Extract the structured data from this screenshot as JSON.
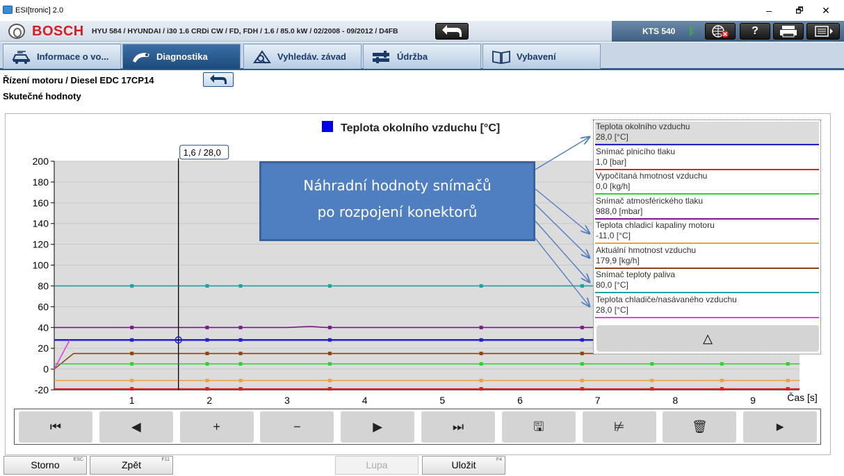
{
  "window": {
    "title": "ESI[tronic] 2.0",
    "controls": [
      "–",
      "🗗",
      "✕"
    ]
  },
  "header": {
    "brand": "BOSCH",
    "vehicle": "HYU 584 / HYUNDAI / i30 1.6 CRDi CW / FD, FDH / 1.6 / 85.0 kW / 02/2008 - 09/2012 / D4FB",
    "device": "KTS 540",
    "icons": [
      "back-arrow-icon",
      "bluetooth-icon",
      "globe-offline-icon",
      "help-icon",
      "print-icon",
      "menu-icon"
    ]
  },
  "tabs": [
    {
      "label": "Informace o vo...",
      "icon": "car-info-icon",
      "active": false
    },
    {
      "label": "Diagnostika",
      "icon": "diagnostics-icon",
      "active": true
    },
    {
      "label": "Vyhledáv. závad",
      "icon": "fault-search-icon",
      "active": false
    },
    {
      "label": "Údržba",
      "icon": "maintenance-icon",
      "active": false
    },
    {
      "label": "Vybavení",
      "icon": "equipment-icon",
      "active": false
    }
  ],
  "breadcrumb": "Řízení motoru / Diesel EDC 17CP14",
  "subtitle": "Skutečné hodnoty",
  "callout": {
    "line1": "Náhradní hodnoty snímačů",
    "line2": "po rozpojení konektorů"
  },
  "legend": {
    "items": [
      {
        "name": "Teplota okolního vzduchu",
        "value": "28,0 [°C]",
        "color": "#2020d0",
        "selected": true
      },
      {
        "name": "Snímač plnicího tlaku",
        "value": "1,0 [bar]",
        "color": "#e02020",
        "selected": false
      },
      {
        "name": "Vypočítaná hmotnost vzduchu",
        "value": "0,0 [kg/h]",
        "color": "#30d030",
        "selected": false
      },
      {
        "name": "Snímač atmosférického tlaku",
        "value": "988,0 [mbar]",
        "color": "#7a1a8a",
        "selected": false
      },
      {
        "name": "Teplota chladicí kapaliny motoru",
        "value": "-11,0 [°C]",
        "color": "#f0a040",
        "selected": false
      },
      {
        "name": "Aktuální hmotnost vzduchu",
        "value": "179,9 [kg/h]",
        "color": "#8b4513",
        "selected": false
      },
      {
        "name": "Snímač teploty paliva",
        "value": "80,0 [°C]",
        "color": "#20a0a0",
        "selected": false
      },
      {
        "name": "Teplota chladiče/nasávaného vzduchu",
        "value": "28,0 [°C]",
        "color": "#e040e0",
        "selected": false
      }
    ],
    "scroll_up": "△"
  },
  "chart_data": {
    "type": "line",
    "title": "Teplota okolního vzduchu [°C]",
    "title_color": "#0000ee",
    "xlabel": "Čas [s]",
    "ylabel": "",
    "xlim": [
      0,
      9.6
    ],
    "ylim": [
      -20,
      200
    ],
    "x_ticks": [
      1,
      2,
      3,
      4,
      5,
      6,
      7,
      8,
      9
    ],
    "y_ticks": [
      -20,
      0,
      20,
      40,
      60,
      80,
      100,
      120,
      140,
      160,
      180,
      200
    ],
    "cursor": {
      "x": 1.6,
      "label": "1,6 / 28,0"
    },
    "series": [
      {
        "color": "#20a0a0",
        "x": [
          0,
          9.6
        ],
        "y": [
          80,
          80
        ],
        "markers": [
          1.0,
          1.97,
          2.4,
          3.55,
          5.5,
          6.8
        ]
      },
      {
        "color": "#7a1a8a",
        "x": [
          0,
          3.0,
          3.3,
          3.5,
          9.6
        ],
        "y": [
          40,
          40,
          41,
          40,
          40
        ],
        "markers": [
          1.0,
          1.97,
          2.4,
          3.55,
          5.5,
          6.8
        ]
      },
      {
        "color": "#2020d0",
        "x": [
          0,
          9.6
        ],
        "y": [
          28,
          28
        ],
        "markers": [
          1.0,
          1.97,
          2.4,
          3.55,
          5.5,
          6.8
        ]
      },
      {
        "color": "#8b4513",
        "x": [
          0,
          0.25,
          9.6
        ],
        "y": [
          0,
          15,
          15
        ],
        "markers": [
          1.0,
          1.97,
          2.4,
          3.55,
          5.5,
          6.8
        ]
      },
      {
        "color": "#30d030",
        "x": [
          0,
          9.6
        ],
        "y": [
          5,
          5
        ],
        "markers": [
          1.0,
          1.97,
          2.4,
          3.55,
          5.5,
          6.8,
          7.7,
          8.6,
          9.45
        ]
      },
      {
        "color": "#f0a040",
        "x": [
          0,
          9.6
        ],
        "y": [
          -11,
          -11
        ],
        "markers": [
          1.0,
          1.97,
          2.4,
          3.55,
          5.5,
          6.8,
          7.7,
          8.6,
          9.45
        ]
      },
      {
        "color": "#e02020",
        "x": [
          0,
          9.6
        ],
        "y": [
          -19,
          -19
        ],
        "markers": [
          1.0,
          1.97,
          2.4,
          3.55,
          5.5,
          6.8,
          7.7,
          8.6,
          9.45
        ]
      },
      {
        "color": "#e040e0",
        "x": [
          0,
          0.2
        ],
        "y": [
          0,
          28
        ],
        "markers": []
      }
    ]
  },
  "controls": [
    {
      "icon": "skip-to-start-icon",
      "glyph": "⏮"
    },
    {
      "icon": "step-back-icon",
      "glyph": "◀"
    },
    {
      "icon": "zoom-in-icon",
      "glyph": "+"
    },
    {
      "icon": "zoom-out-icon",
      "glyph": "−"
    },
    {
      "icon": "step-forward-icon",
      "glyph": "▶"
    },
    {
      "icon": "skip-to-end-icon",
      "glyph": "⏭"
    },
    {
      "icon": "save-icon",
      "glyph": "🖫"
    },
    {
      "icon": "chart-scale-icon",
      "glyph": "⊭"
    },
    {
      "icon": "delete-icon",
      "glyph": "🗑"
    },
    {
      "icon": "play-icon",
      "glyph": "►"
    }
  ],
  "bottom": {
    "storno": {
      "label": "Storno",
      "key": "ESC"
    },
    "zpet": {
      "label": "Zpět",
      "key": "F11"
    },
    "lupa": {
      "label": "Lupa",
      "key": ""
    },
    "ulozit": {
      "label": "Uložit",
      "key": "F4"
    }
  }
}
